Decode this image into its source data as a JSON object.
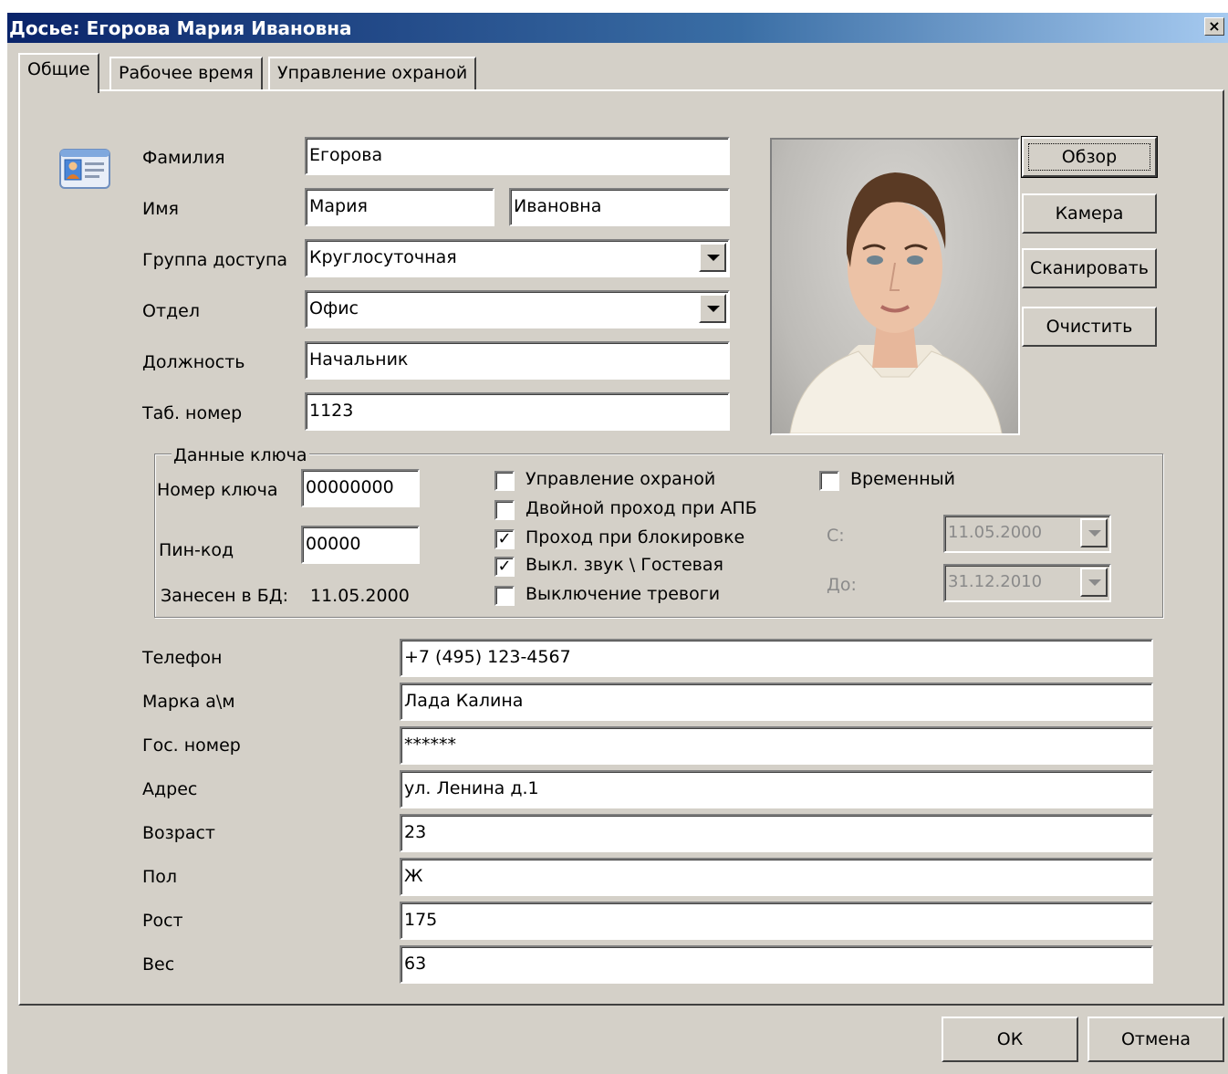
{
  "window": {
    "title": "Досье: Егорова Мария Ивановна",
    "close_glyph": "×"
  },
  "tabs": [
    {
      "label": "Общие"
    },
    {
      "label": "Рабочее время"
    },
    {
      "label": "Управление охраной"
    }
  ],
  "person": {
    "last_name_label": "Фамилия",
    "last_name": "Егорова",
    "first_name_label": "Имя",
    "first_name": "Мария",
    "patronymic": "Ивановна",
    "access_group_label": "Группа доступа",
    "access_group": "Круглосуточная",
    "department_label": "Отдел",
    "department": "Офис",
    "position_label": "Должность",
    "position": "Начальник",
    "tab_number_label": "Таб. номер",
    "tab_number": "1123"
  },
  "photo_buttons": {
    "browse": "Обзор",
    "camera": "Камера",
    "scan": "Сканировать",
    "clear": "Очистить"
  },
  "key_data": {
    "legend": "Данные ключа",
    "key_number_label": "Номер ключа",
    "key_number": "00000000",
    "pin_label": "Пин-код",
    "pin": "00000",
    "added_label": "Занесен в БД:",
    "added_date": "11.05.2000",
    "checkboxes": [
      {
        "label": "Управление охраной",
        "checked": false
      },
      {
        "label": "Двойной проход при АПБ",
        "checked": false
      },
      {
        "label": "Проход при блокировке",
        "checked": true
      },
      {
        "label": "Выкл. звук \\ Гостевая",
        "checked": true
      },
      {
        "label": "Выключение тревоги",
        "checked": false
      }
    ],
    "temporary_label": "Временный",
    "temporary_checked": false,
    "from_label": "С:",
    "from_date": "11.05.2000",
    "to_label": "До:",
    "to_date": "31.12.2010",
    "check_glyph": "✓"
  },
  "extra_fields": [
    {
      "label": "Телефон",
      "value": "+7 (495) 123-4567"
    },
    {
      "label": "Марка а\\м",
      "value": "Лада Калина"
    },
    {
      "label": "Гос. номер",
      "value": "******"
    },
    {
      "label": "Адрес",
      "value": "ул. Ленина д.1"
    },
    {
      "label": "Возраст",
      "value": "23"
    },
    {
      "label": "Пол",
      "value": "Ж"
    },
    {
      "label": "Рост",
      "value": "175"
    },
    {
      "label": "Вес",
      "value": "63"
    }
  ],
  "footer": {
    "ok": "ОК",
    "cancel": "Отмена"
  }
}
